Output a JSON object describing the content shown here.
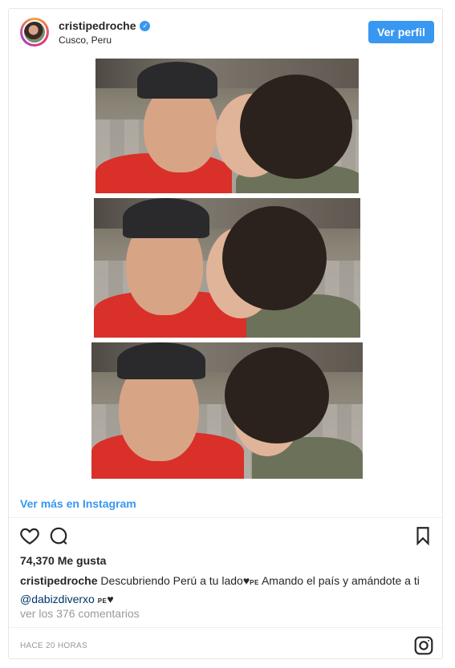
{
  "post": {
    "username": "cristipedroche",
    "verified_icon": "verified-badge-icon",
    "location": "Cusco, Peru",
    "view_profile_label": "Ver perfil",
    "view_more_label": "Ver más en Instagram",
    "likes": "74,370 Me gusta",
    "caption": {
      "username": "cristipedroche",
      "text_1": "Descubriendo Perú a tu lado",
      "flag_1": "PE",
      "text_2": "Amando el país y amándote a ti",
      "mention": "@dabizdiverxo",
      "flag_2": "PE"
    },
    "comments_label": "ver los 376 comentarios",
    "timestamp": "HACE 20 HORAS"
  },
  "icons": {
    "like": "heart-icon",
    "comment": "comment-icon",
    "save": "bookmark-icon",
    "brand": "instagram-icon"
  },
  "colors": {
    "accent": "#3897f0",
    "mention": "#003569",
    "muted": "#999999",
    "text": "#262626"
  }
}
